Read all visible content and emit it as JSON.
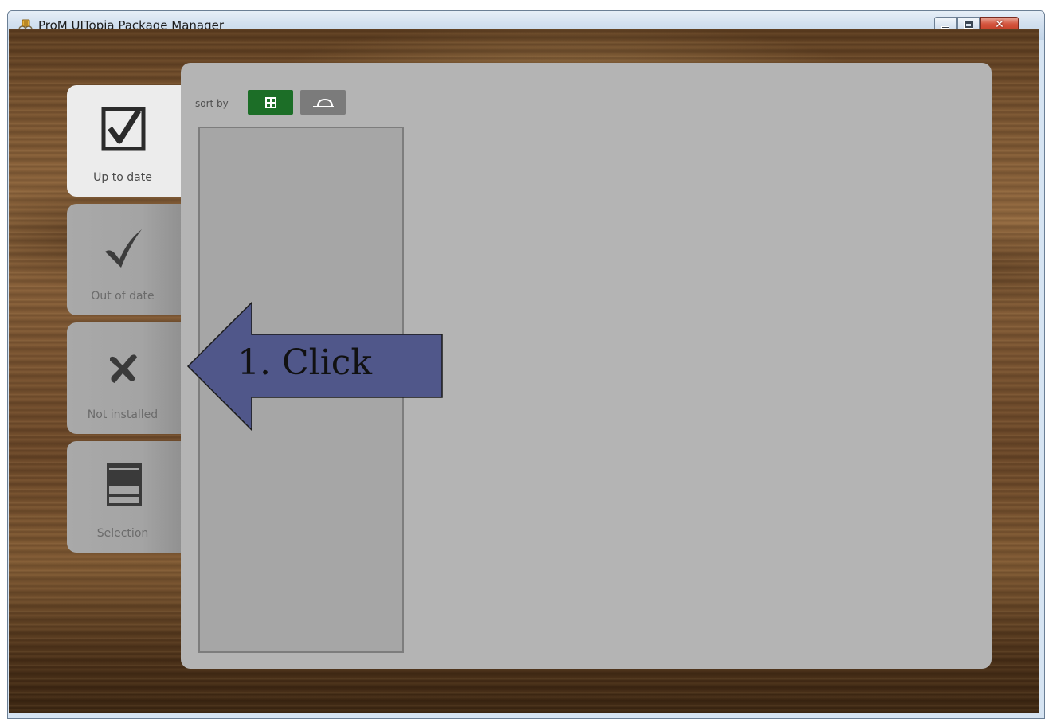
{
  "window": {
    "title": "ProM UITopia Package Manager",
    "controls": {
      "minimize": "minimize-icon",
      "maximize": "maximize-icon",
      "close": "close-icon"
    }
  },
  "tabs": [
    {
      "label": "Up to date",
      "icon": "checkbox-checked-icon",
      "active": true
    },
    {
      "label": "Out of date",
      "icon": "checkmark-icon",
      "active": false
    },
    {
      "label": "Not installed",
      "icon": "cross-icon",
      "active": false
    },
    {
      "label": "Selection",
      "icon": "list-icon",
      "active": false
    }
  ],
  "main": {
    "sort_label": "sort by",
    "sort_options": [
      {
        "icon": "grid-icon",
        "selected": true
      },
      {
        "icon": "dome-icon",
        "selected": false
      }
    ]
  },
  "annotation": {
    "text": "1. Click"
  },
  "colors": {
    "accent_green": "#1c6e27",
    "panel_gray": "#b4b4b4",
    "arrow_fill": "#50578a"
  }
}
